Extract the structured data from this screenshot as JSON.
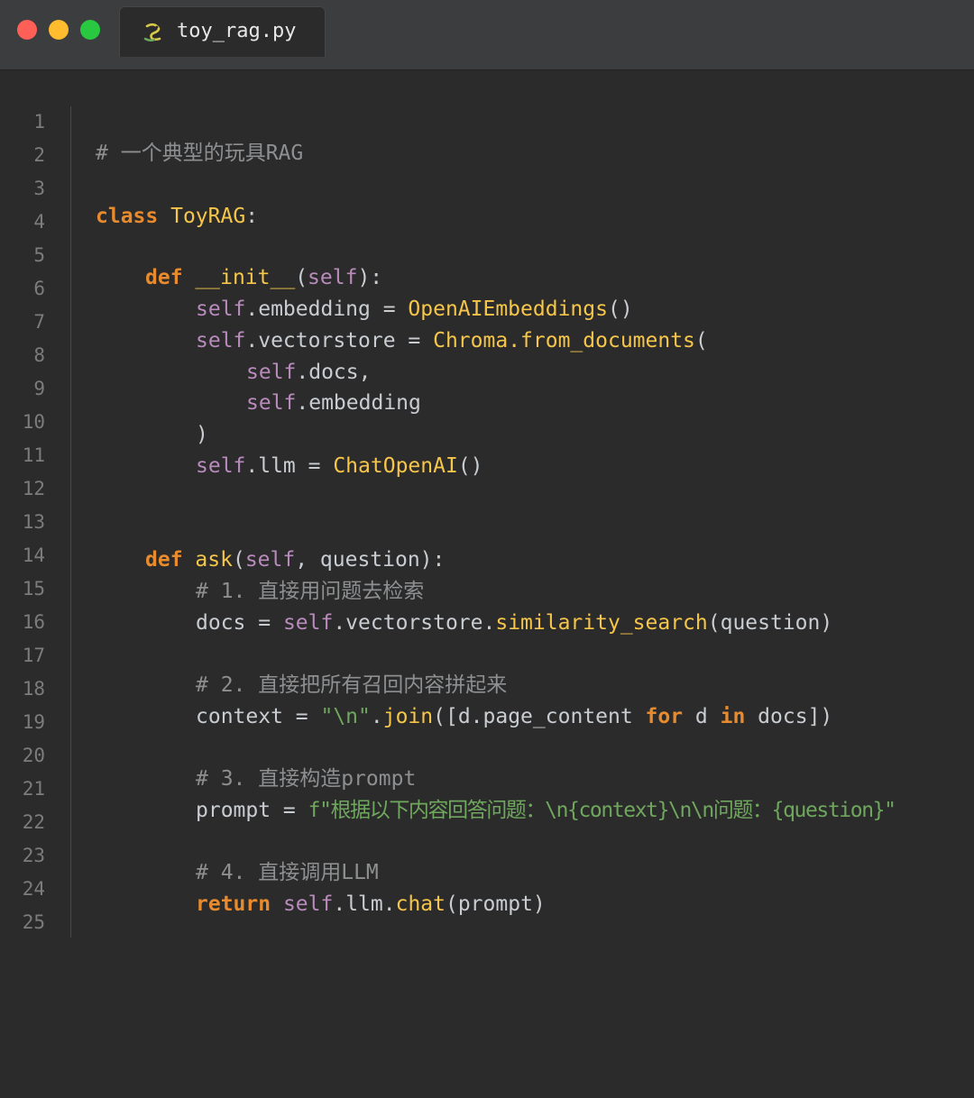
{
  "window": {
    "controls": [
      "close",
      "minimize",
      "zoom"
    ],
    "tab": {
      "label": "toy_rag.py",
      "icon": "python-file-icon"
    }
  },
  "colors": {
    "background": "#2b2b2b",
    "titlebar": "#3b3d3f",
    "keyword": "#e78b2e",
    "self": "#b98bbd",
    "function": "#f6c64a",
    "string": "#6fa75e",
    "comment": "#8d8f91",
    "text": "#c9cdd2",
    "line_number": "#7c7c7c"
  },
  "editor": {
    "line_numbers": [
      "1",
      "2",
      "3",
      "4",
      "5",
      "6",
      "7",
      "8",
      "9",
      "10",
      "11",
      "12",
      "13",
      "14",
      "15",
      "16",
      "17",
      "18",
      "19",
      "20",
      "21",
      "22",
      "23",
      "24",
      "25"
    ],
    "code": {
      "l2": {
        "comment": "# 一个典型的玩具RAG"
      },
      "l4": {
        "kw": "class",
        "name": "ToyRAG",
        "colon": ":"
      },
      "l6": {
        "kw": "def",
        "name": "__init__",
        "open": "(",
        "self": "self",
        "close": "):"
      },
      "l7": {
        "self": "self",
        "text": ".embedding = ",
        "call": "OpenAIEmbeddings",
        "tail": "()"
      },
      "l8": {
        "self": "self",
        "text": ".vectorstore = ",
        "call": "Chroma.from_documents",
        "tail": "("
      },
      "l9": {
        "self": "self",
        "text": ".docs,"
      },
      "l10": {
        "self": "self",
        "text": ".embedding"
      },
      "l11": {
        "text": ")"
      },
      "l12": {
        "self": "self",
        "text": ".llm = ",
        "call": "ChatOpenAI",
        "tail": "()"
      },
      "l14": {
        "kw": "def",
        "name": "ask",
        "open": "(",
        "self": "self",
        "rest": ", question):"
      },
      "l15": {
        "comment": "# 1. 直接用问题去检索"
      },
      "l16": {
        "pre": "docs = ",
        "self": "self",
        "mid": ".vectorstore.",
        "call": "similarity_search",
        "tail": "(question)"
      },
      "l18": {
        "comment": "# 2. 直接把所有召回内容拼起来"
      },
      "l19": {
        "pre": "context = ",
        "str": "\"\\n\"",
        "dot": ".",
        "call": "join",
        "a": "([d.page_content ",
        "kw1": "for",
        "b": " d ",
        "kw2": "in",
        "c": " docs])"
      },
      "l21": {
        "comment": "# 3. 直接构造prompt"
      },
      "l22": {
        "pre": "prompt = ",
        "str": "f\"根据以下内容回答问题：\\n{context}\\n\\n问题：{question}\""
      },
      "l24": {
        "comment": "# 4. 直接调用LLM"
      },
      "l25": {
        "kw": "return",
        "sp": " ",
        "self": "self",
        "mid": ".llm.",
        "call": "chat",
        "tail": "(prompt)"
      }
    }
  }
}
